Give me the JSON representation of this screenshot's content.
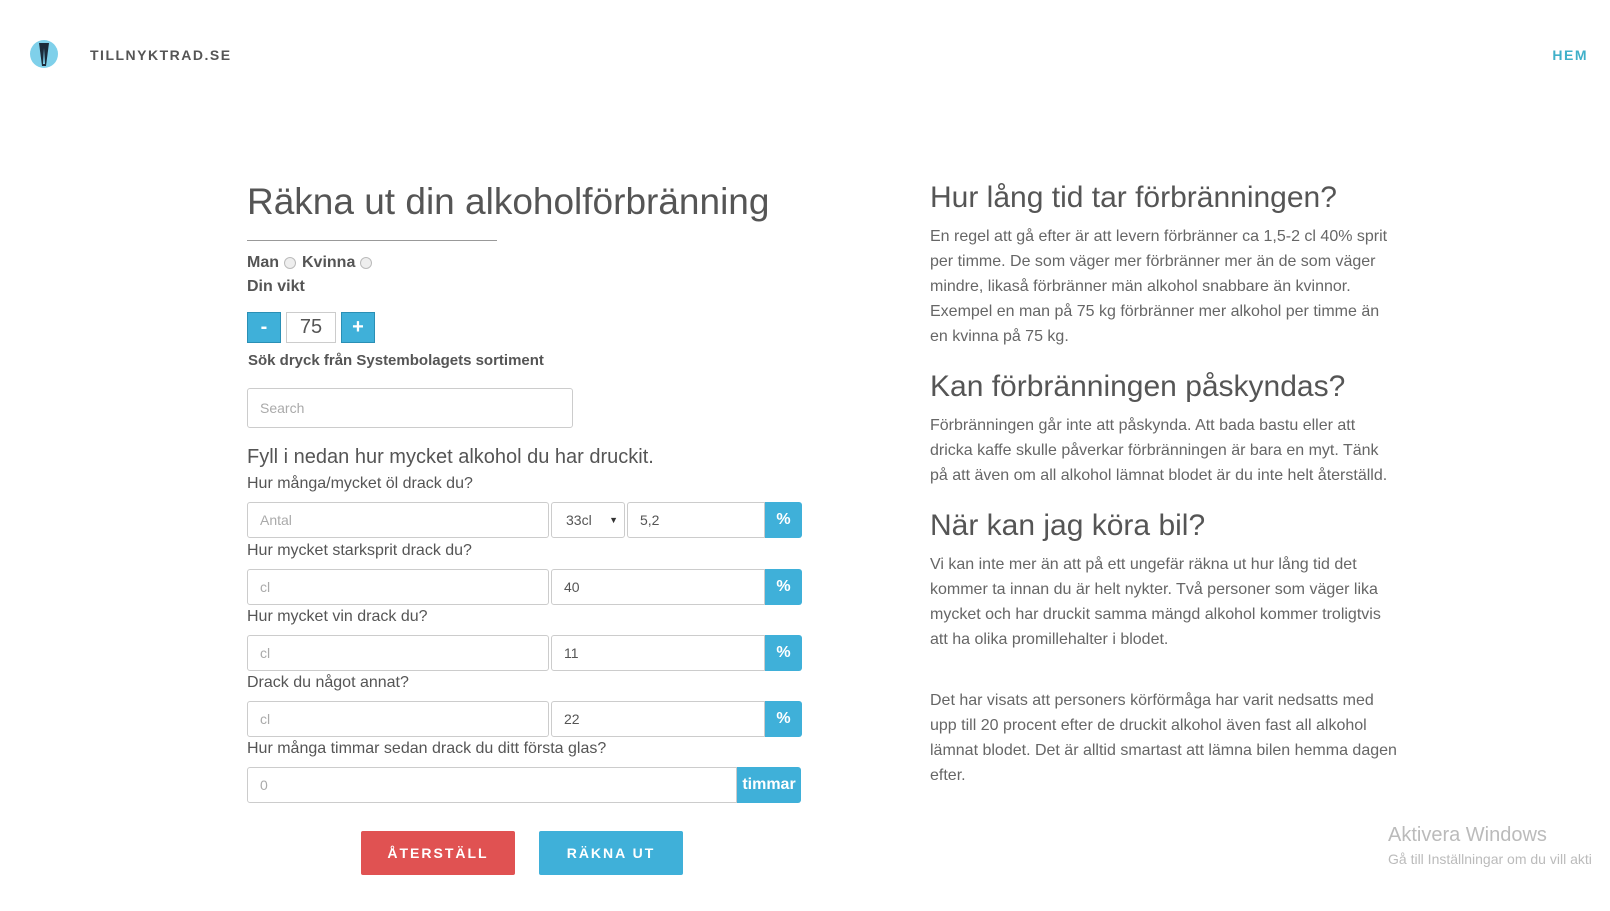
{
  "header": {
    "brand": "TILLNYKTRAD.SE",
    "nav_home": "HEM"
  },
  "form": {
    "title": "Räkna ut din alkoholförbränning",
    "gender_man": "Man",
    "gender_woman": "Kvinna",
    "weight_label": "Din vikt",
    "weight_minus": "-",
    "weight_value": "75",
    "weight_plus": "+",
    "search_label": "Sök dryck från Systembolagets sortiment",
    "search_placeholder": "Search",
    "intro": "Fyll i nedan hur mycket alkohol du har druckit.",
    "beer_question": "Hur många/mycket öl drack du?",
    "beer_amount_placeholder": "Antal",
    "beer_size": "33cl",
    "beer_percent": "5,2",
    "spirits_question": "Hur mycket starksprit drack du?",
    "spirits_placeholder": "cl",
    "spirits_percent": "40",
    "wine_question": "Hur mycket vin drack du?",
    "wine_placeholder": "cl",
    "wine_percent": "11",
    "other_question": "Drack du något annat?",
    "other_placeholder": "cl",
    "other_percent": "22",
    "hours_question": "Hur många timmar sedan drack du ditt första glas?",
    "hours_placeholder": "0",
    "percent_symbol": "%",
    "hours_unit": "timmar",
    "reset_button": "ÅTERSTÄLL",
    "calculate_button": "RÄKNA UT"
  },
  "info": {
    "h1": "Hur lång tid tar förbränningen?",
    "p1": "En regel att gå efter är att levern förbränner ca 1,5-2 cl 40% sprit per timme. De som väger mer förbränner mer än de som väger mindre, likaså förbränner män alkohol snabbare än kvinnor. Exempel en man på 75 kg förbränner mer alkohol per timme än en kvinna på 75 kg.",
    "h2": "Kan förbränningen påskyndas?",
    "p2": "Förbränningen går inte att påskynda. Att bada bastu eller att dricka kaffe skulle påverkar förbränningen är bara en myt. Tänk på att även om all alkohol lämnat blodet är du inte helt återställd.",
    "h3": "När kan jag köra bil?",
    "p3": "Vi kan inte mer än att på ett ungefär räkna ut hur lång tid det kommer ta innan du är helt nykter. Två personer som väger lika mycket och har druckit samma mängd alkohol kommer troligtvis att ha olika promillehalter i blodet.",
    "p4": "Det har visats att personers körförmåga har varit nedsatts med upp till 20 procent efter de druckit alkohol även fast all alkohol lämnat blodet. Det är alltid smartast att lämna bilen hemma dagen efter."
  },
  "watermark": {
    "title": "Aktivera Windows",
    "subtitle": "Gå till Inställningar om du vill akti"
  },
  "colors": {
    "accent": "#3fb0d9",
    "danger": "#e05252",
    "nav": "#3fb0c9"
  }
}
